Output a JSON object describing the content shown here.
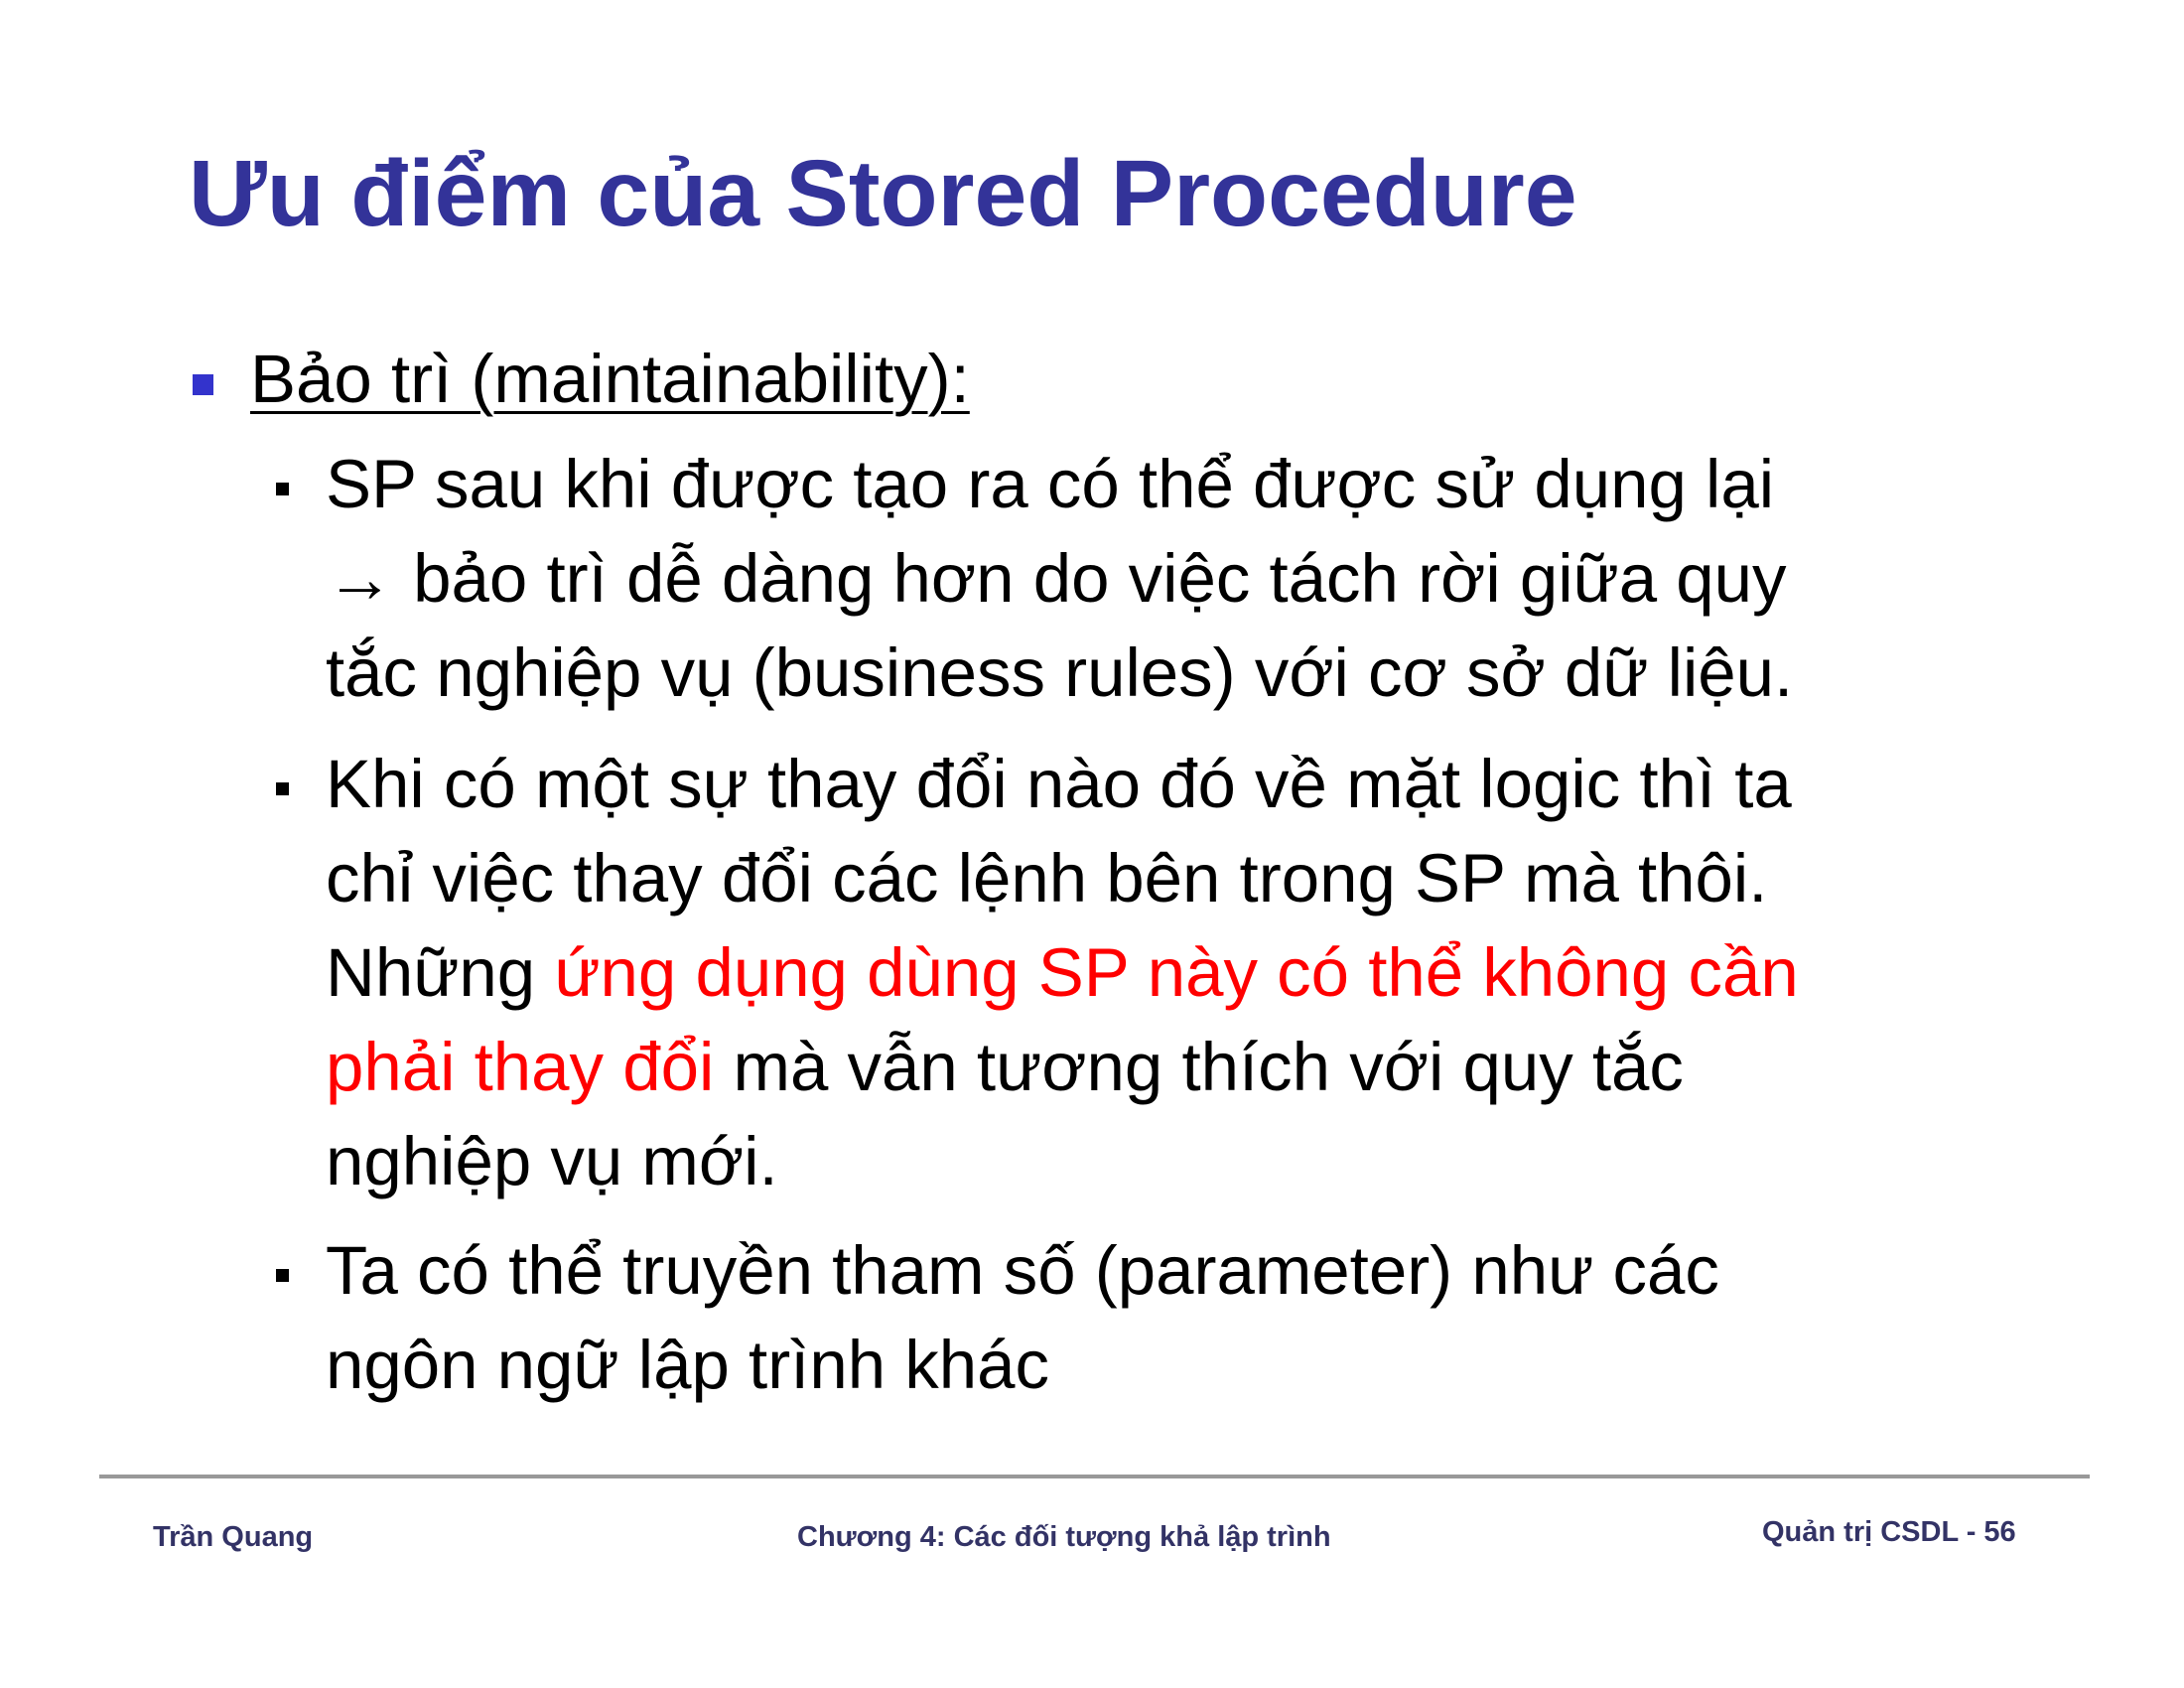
{
  "title": "Ưu điểm của Stored Procedure",
  "section": {
    "label": "Bảo trì (maintainability):",
    "items": [
      {
        "lines": [
          "SP sau khi được tạo ra có thể được sử dụng lại",
          "→ bảo trì dễ dàng hơn do việc tách rời giữa quy",
          "tắc nghiệp vụ (business rules) với cơ sở dữ liệu."
        ]
      },
      {
        "line1": "Khi có một sự thay đổi nào đó về mặt logic thì ta",
        "line2": "chỉ việc thay đổi các lệnh bên trong SP mà thôi.",
        "line3_plain": "Những ",
        "line3_highlight": "ứng dụng dùng SP này có thể không cần",
        "line4_highlight": "phải thay đổi",
        "line4_plain": " mà vẫn tương thích với quy tắc",
        "line5": "nghiệp vụ mới."
      },
      {
        "lines": [
          "Ta có thể truyền tham số (parameter) như các",
          "ngôn ngữ lập trình khác"
        ]
      }
    ]
  },
  "footer": {
    "author": "Trần Quang",
    "chapter": "Chương 4: Các đối tượng khả lập trình",
    "course_page": "Quản trị CSDL - 56"
  },
  "colors": {
    "title": "#333399",
    "highlight": "#ff0000",
    "bullet_level1": "#3333cc",
    "footer_text": "#333366",
    "footer_rule": "#999999"
  }
}
